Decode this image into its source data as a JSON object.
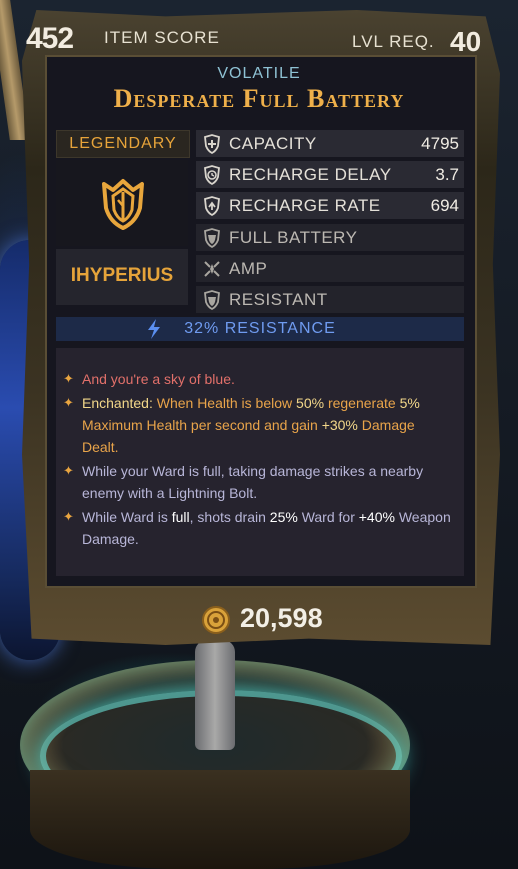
{
  "header": {
    "item_score": "452",
    "item_score_label": "ITEM SCORE",
    "level_label": "LVL REQ.",
    "level": "40"
  },
  "item": {
    "prefix": "VOLATILE",
    "name": "Desperate Full Battery",
    "rarity": "LEGENDARY",
    "manufacturer": "IHYPERIUS",
    "emblem_icon": "shield-emblem-icon"
  },
  "stats": [
    {
      "label": "CAPACITY",
      "value": "4795",
      "icon": "shield-plus-icon"
    },
    {
      "label": "RECHARGE DELAY",
      "value": "3.7",
      "icon": "shield-timer-icon"
    },
    {
      "label": "RECHARGE RATE",
      "value": "694",
      "icon": "shield-recharge-icon"
    },
    {
      "label": "FULL BATTERY",
      "value": "",
      "icon": "shield-perk-icon"
    },
    {
      "label": "AMP",
      "value": "",
      "icon": "amp-icon"
    },
    {
      "label": "RESISTANT",
      "value": "",
      "icon": "shield-perk-icon"
    }
  ],
  "resistance": {
    "text": "32% RESISTANCE",
    "icon": "lightning-icon"
  },
  "description": {
    "flavor": "And you're a sky of blue.",
    "enchanted": {
      "label": "Enchanted:",
      "t1": " When Health is below ",
      "v1": "50%",
      "t2": " regenerate ",
      "v2": "5%",
      "t3": " Maximum Health per second and gain ",
      "v3": "+30%",
      "t4": " Damage Dealt."
    },
    "ward_bolt": "While your Ward is full, taking damage strikes a nearby enemy with a Lightning Bolt.",
    "ward_drain": {
      "t1": "While Ward is ",
      "v1": "full",
      "t2": ", shots drain ",
      "v2": "25%",
      "t3": " Ward for ",
      "v3": "+40%",
      "t4": " Weapon Damage."
    }
  },
  "price": {
    "value": "20,598",
    "icon": "coin-icon"
  },
  "colors": {
    "legendary": "#efb04a",
    "resistance": "#6f9bf0",
    "flavor": "#e2706a"
  }
}
